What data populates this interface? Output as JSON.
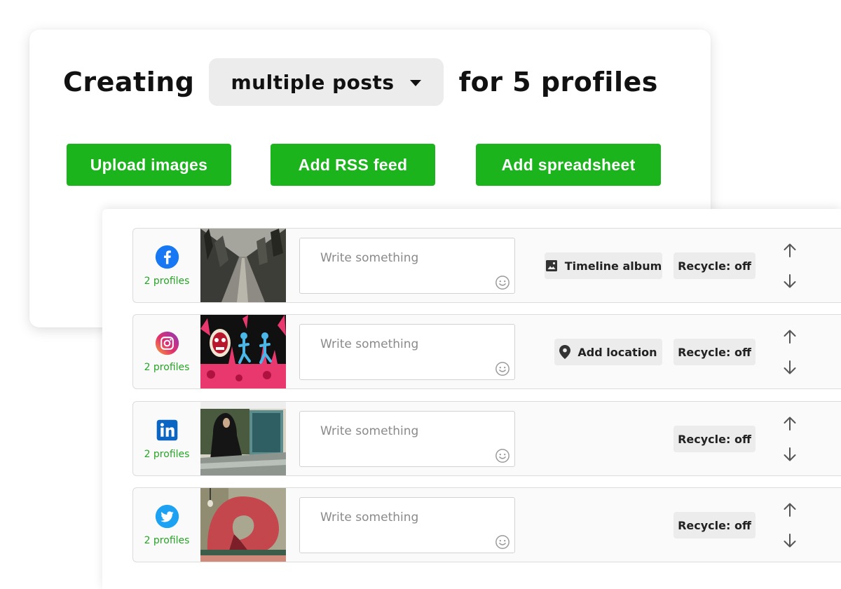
{
  "header": {
    "prefix": "Creating",
    "post_type": "multiple posts",
    "suffix": "for 5 profiles"
  },
  "actions": {
    "upload": "Upload images",
    "rss": "Add RSS feed",
    "spreadsheet": "Add spreadsheet"
  },
  "colors": {
    "accent_green": "#1cb41c",
    "profile_count_green": "#26a626",
    "facebook": "#1877f2",
    "linkedin": "#0a66c2",
    "twitter": "#1da1f2"
  },
  "posts": [
    {
      "network": "facebook-icon",
      "profiles": "2 profiles",
      "placeholder": "Write something",
      "extra_chip": "Timeline album",
      "extra_chip_icon": "photo-album-icon",
      "recycle": "Recycle: off"
    },
    {
      "network": "instagram-icon",
      "profiles": "2 profiles",
      "placeholder": "Write something",
      "extra_chip": "Add location",
      "extra_chip_icon": "location-pin-icon",
      "recycle": "Recycle: off"
    },
    {
      "network": "linkedin-icon",
      "profiles": "2 profiles",
      "placeholder": "Write something",
      "recycle": "Recycle: off"
    },
    {
      "network": "twitter-icon",
      "profiles": "2 profiles",
      "placeholder": "Write something",
      "recycle": "Recycle: off"
    }
  ]
}
